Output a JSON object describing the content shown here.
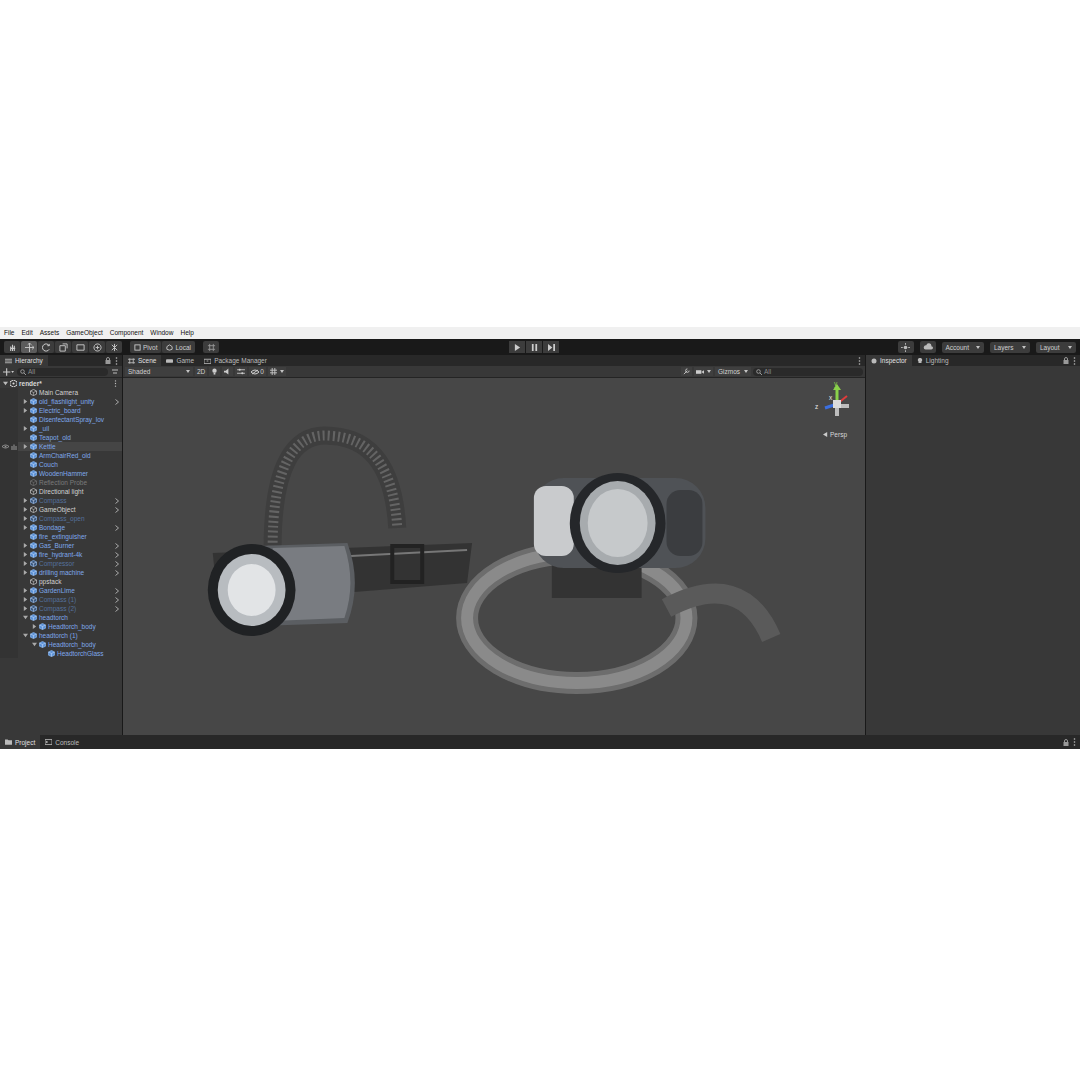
{
  "menu": [
    "File",
    "Edit",
    "Assets",
    "GameObject",
    "Component",
    "Window",
    "Help"
  ],
  "toolbar": {
    "tools": [
      {
        "selected": false
      },
      {
        "selected": true
      },
      {
        "selected": false
      },
      {
        "selected": false
      },
      {
        "selected": false
      },
      {
        "selected": false
      },
      {
        "selected": false
      }
    ],
    "pivot": "Pivot",
    "space": "Local",
    "play_controls": [
      {
        "selected": false
      },
      {
        "selected": false
      },
      {
        "selected": false
      }
    ],
    "account": "Account",
    "layers": "Layers",
    "layout": "Layout"
  },
  "hierarchy": {
    "tab": "Hierarchy",
    "search_placeholder": "All",
    "scene": "render*",
    "items": [
      {
        "label": "Main Camera",
        "depth": 0,
        "prefab": false,
        "active": true,
        "has_children": false,
        "expanded": false,
        "open_arrow": false,
        "highlighted": false
      },
      {
        "label": "old_flashlight_unity",
        "depth": 0,
        "prefab": true,
        "active": true,
        "has_children": true,
        "expanded": false,
        "open_arrow": true,
        "highlighted": false
      },
      {
        "label": "Electric_board",
        "depth": 0,
        "prefab": true,
        "active": true,
        "has_children": true,
        "expanded": false,
        "open_arrow": false,
        "highlighted": false
      },
      {
        "label": "DisenfectantSpray_lov",
        "depth": 0,
        "prefab": true,
        "active": true,
        "has_children": false,
        "expanded": false,
        "open_arrow": false,
        "highlighted": false
      },
      {
        "label": "_uil",
        "depth": 0,
        "prefab": true,
        "active": true,
        "has_children": true,
        "expanded": false,
        "open_arrow": false,
        "highlighted": false
      },
      {
        "label": "Teapot_old",
        "depth": 0,
        "prefab": true,
        "active": true,
        "has_children": false,
        "expanded": false,
        "open_arrow": false,
        "highlighted": false
      },
      {
        "label": "Kettle",
        "depth": 0,
        "prefab": true,
        "active": true,
        "has_children": true,
        "expanded": false,
        "open_arrow": false,
        "highlighted": true
      },
      {
        "label": "ArmChairRed_old",
        "depth": 0,
        "prefab": true,
        "active": true,
        "has_children": false,
        "expanded": false,
        "open_arrow": false,
        "highlighted": false
      },
      {
        "label": "Couch",
        "depth": 0,
        "prefab": true,
        "active": true,
        "has_children": false,
        "expanded": false,
        "open_arrow": false,
        "highlighted": false
      },
      {
        "label": "WoodenHammer",
        "depth": 0,
        "prefab": true,
        "active": true,
        "has_children": false,
        "expanded": false,
        "open_arrow": false,
        "highlighted": false
      },
      {
        "label": "Reflection Probe",
        "depth": 0,
        "prefab": false,
        "active": false,
        "has_children": false,
        "expanded": false,
        "open_arrow": false,
        "highlighted": false
      },
      {
        "label": "Directional light",
        "depth": 0,
        "prefab": false,
        "active": true,
        "has_children": false,
        "expanded": false,
        "open_arrow": false,
        "highlighted": false
      },
      {
        "label": "Compass",
        "depth": 0,
        "prefab": true,
        "active": false,
        "has_children": true,
        "expanded": false,
        "open_arrow": true,
        "highlighted": false
      },
      {
        "label": "GameObject",
        "depth": 0,
        "prefab": false,
        "active": true,
        "has_children": true,
        "expanded": false,
        "open_arrow": true,
        "highlighted": false
      },
      {
        "label": "Compass_open",
        "depth": 0,
        "prefab": true,
        "active": false,
        "has_children": true,
        "expanded": false,
        "open_arrow": false,
        "highlighted": false
      },
      {
        "label": "Bondage",
        "depth": 0,
        "prefab": true,
        "active": true,
        "has_children": true,
        "expanded": false,
        "open_arrow": true,
        "highlighted": false
      },
      {
        "label": "fire_extinguisher",
        "depth": 0,
        "prefab": true,
        "active": true,
        "has_children": false,
        "expanded": false,
        "open_arrow": false,
        "highlighted": false
      },
      {
        "label": "Gas_Burner",
        "depth": 0,
        "prefab": true,
        "active": true,
        "has_children": true,
        "expanded": false,
        "open_arrow": true,
        "highlighted": false
      },
      {
        "label": "fire_hydrant-4k",
        "depth": 0,
        "prefab": true,
        "active": true,
        "has_children": true,
        "expanded": false,
        "open_arrow": true,
        "highlighted": false
      },
      {
        "label": "Compressor",
        "depth": 0,
        "prefab": true,
        "active": false,
        "has_children": true,
        "expanded": false,
        "open_arrow": true,
        "highlighted": false
      },
      {
        "label": "drilling machine",
        "depth": 0,
        "prefab": true,
        "active": true,
        "has_children": true,
        "expanded": false,
        "open_arrow": true,
        "highlighted": false
      },
      {
        "label": "ppstack",
        "depth": 0,
        "prefab": false,
        "active": true,
        "has_children": false,
        "expanded": false,
        "open_arrow": false,
        "highlighted": false
      },
      {
        "label": "GardenLime",
        "depth": 0,
        "prefab": true,
        "active": true,
        "has_children": true,
        "expanded": false,
        "open_arrow": true,
        "highlighted": false
      },
      {
        "label": "Compass (1)",
        "depth": 0,
        "prefab": true,
        "active": false,
        "has_children": true,
        "expanded": false,
        "open_arrow": true,
        "highlighted": false
      },
      {
        "label": "Compass (2)",
        "depth": 0,
        "prefab": true,
        "active": false,
        "has_children": true,
        "expanded": false,
        "open_arrow": true,
        "highlighted": false
      },
      {
        "label": "headtorch",
        "depth": 0,
        "prefab": true,
        "active": true,
        "has_children": true,
        "expanded": true,
        "open_arrow": false,
        "highlighted": false
      },
      {
        "label": "Headtorch_body",
        "depth": 1,
        "prefab": true,
        "active": true,
        "has_children": true,
        "expanded": false,
        "open_arrow": false,
        "highlighted": false
      },
      {
        "label": "headtorch (1)",
        "depth": 0,
        "prefab": true,
        "active": true,
        "has_children": true,
        "expanded": true,
        "open_arrow": false,
        "highlighted": false
      },
      {
        "label": "Headtorch_body",
        "depth": 1,
        "prefab": true,
        "active": true,
        "has_children": true,
        "expanded": true,
        "open_arrow": false,
        "highlighted": false
      },
      {
        "label": "HeadtorchGlass",
        "depth": 2,
        "prefab": true,
        "active": true,
        "has_children": false,
        "expanded": false,
        "open_arrow": false,
        "highlighted": false
      }
    ]
  },
  "scene": {
    "tabs": [
      {
        "label": "Scene",
        "selected": true
      },
      {
        "label": "Game",
        "selected": false
      },
      {
        "label": "Package Manager",
        "selected": false
      }
    ],
    "draw_mode": "Shaded",
    "mode_2d": {
      "label": "2D",
      "selected": false
    },
    "hidden_count": "0",
    "gizmos": "Gizmos",
    "search_placeholder": "All",
    "axes": [
      "y",
      "x",
      "z"
    ],
    "projection": "Persp"
  },
  "inspector": {
    "tabs": [
      {
        "label": "Inspector",
        "selected": true
      },
      {
        "label": "Lighting",
        "selected": false
      }
    ]
  },
  "bottom_tabs": [
    {
      "label": "Project",
      "selected": true
    },
    {
      "label": "Console",
      "selected": false
    }
  ]
}
